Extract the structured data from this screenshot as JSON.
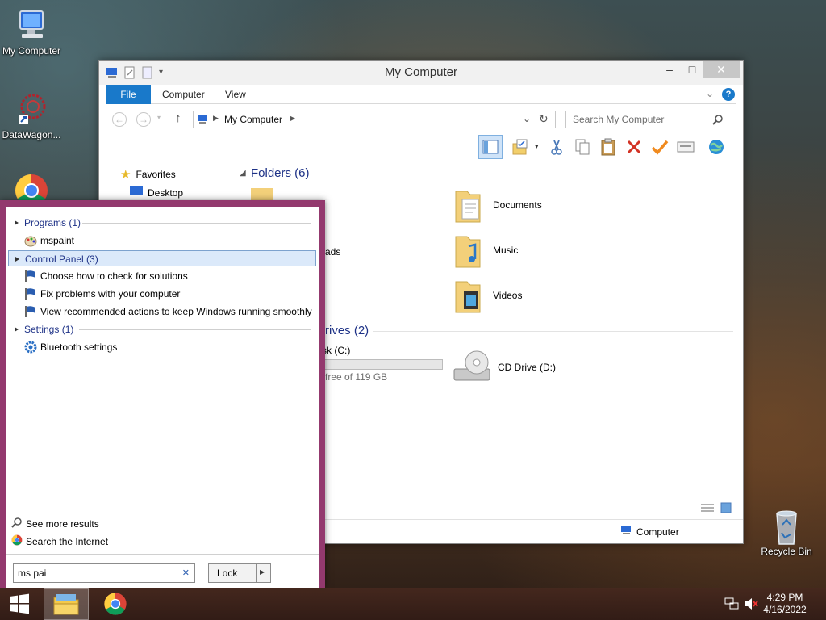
{
  "desktop": {
    "icons": [
      {
        "label": "My Computer"
      },
      {
        "label": "DataWagon..."
      },
      {
        "label": "Recycle Bin"
      }
    ]
  },
  "window": {
    "title": "My Computer",
    "controls": {
      "minimize": "–",
      "maximize": "□",
      "close": "✕"
    },
    "ribbon_tabs": [
      "File",
      "Computer",
      "View"
    ],
    "address": {
      "path": "My Computer"
    },
    "search_placeholder": "Search My Computer",
    "nav_pane": {
      "favorites": "Favorites",
      "desktop": "Desktop"
    },
    "folders_header": "Folders (6)",
    "folders": [
      "Documents",
      "Music",
      "Videos"
    ],
    "partial_downloads": "ads",
    "drives_header": "rives (2)",
    "drive_c": {
      "name": "sk (C:)",
      "free": "free of 119 GB",
      "used_fraction": 0.0
    },
    "drive_d": {
      "name": "CD Drive (D:)"
    },
    "status": {
      "location": "Computer"
    }
  },
  "start_search": {
    "groups": {
      "programs": {
        "label": "Programs (1)",
        "items": [
          "mspaint"
        ]
      },
      "control_panel": {
        "label": "Control Panel (3)",
        "items": [
          "Choose how to check for solutions",
          "Fix problems with your computer",
          "View recommended actions to keep Windows running smoothly"
        ]
      },
      "settings": {
        "label": "Settings (1)",
        "items": [
          "Bluetooth settings"
        ]
      }
    },
    "see_more": "See more results",
    "search_internet": "Search the Internet",
    "query": "ms pai",
    "clear": "✕",
    "lock_label": "Lock",
    "lock_arrow": "▶"
  },
  "taskbar": {
    "time": "4:29 PM",
    "date": "4/16/2022"
  },
  "colors": {
    "accent_blue": "#1979ca",
    "start_border": "#93396e",
    "link_blue": "#1e3287"
  }
}
